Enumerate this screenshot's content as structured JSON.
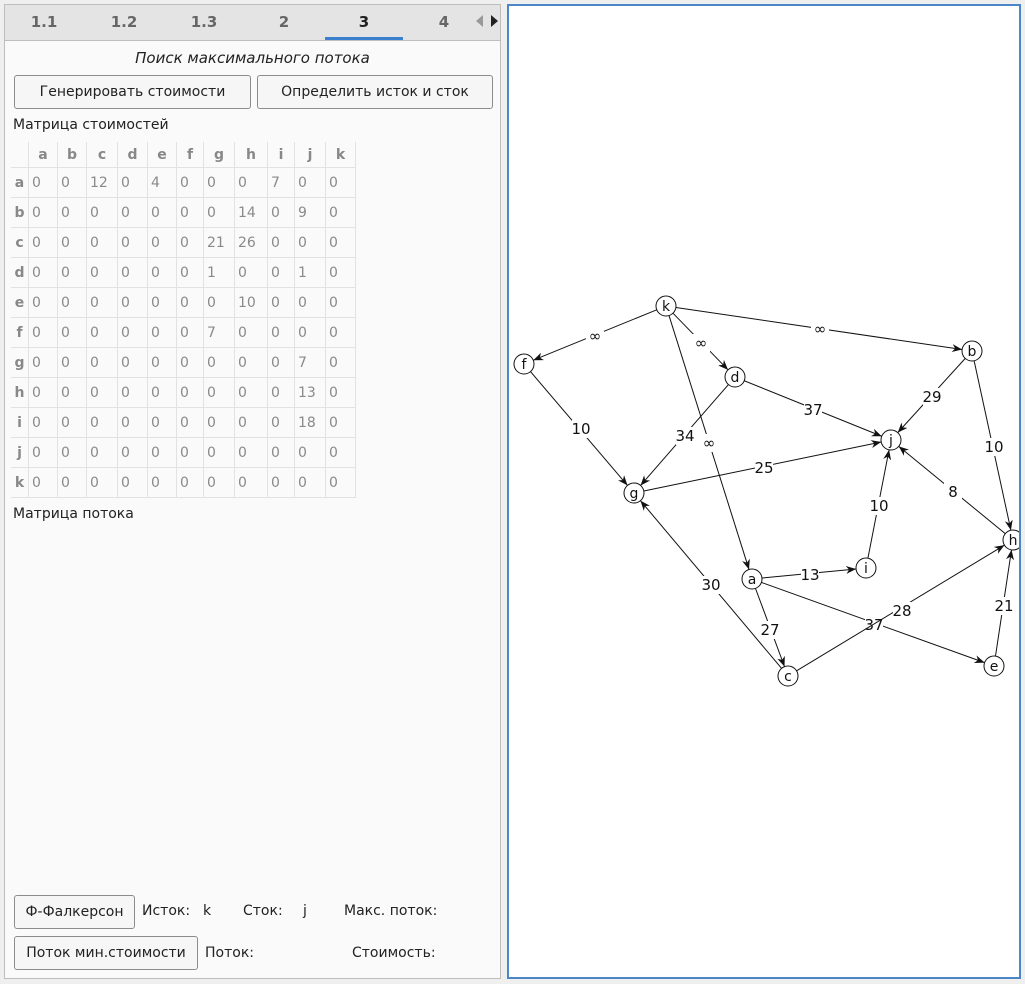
{
  "tabs": [
    {
      "label": "1.1",
      "active": false
    },
    {
      "label": "1.2",
      "active": false
    },
    {
      "label": "1.3",
      "active": false
    },
    {
      "label": "2",
      "active": false
    },
    {
      "label": "3",
      "active": true
    },
    {
      "label": "4",
      "active": false
    }
  ],
  "title": "Поиск максимального потока",
  "buttons": {
    "generate": "Генерировать стоимости",
    "determine": "Определить исток и сток",
    "ford_fulkerson": "Ф-Фалкерсон",
    "min_cost_flow": "Поток мин.стоимости"
  },
  "cost_matrix": {
    "label": "Матрица стоимостей",
    "columns": [
      "a",
      "b",
      "c",
      "d",
      "e",
      "f",
      "g",
      "h",
      "i",
      "j",
      "k"
    ],
    "rows": [
      {
        "name": "a",
        "values": [
          "0",
          "0",
          "12",
          "0",
          "4",
          "0",
          "0",
          "0",
          "7",
          "0",
          "0"
        ]
      },
      {
        "name": "b",
        "values": [
          "0",
          "0",
          "0",
          "0",
          "0",
          "0",
          "0",
          "14",
          "0",
          "9",
          "0"
        ]
      },
      {
        "name": "c",
        "values": [
          "0",
          "0",
          "0",
          "0",
          "0",
          "0",
          "21",
          "26",
          "0",
          "0",
          "0"
        ]
      },
      {
        "name": "d",
        "values": [
          "0",
          "0",
          "0",
          "0",
          "0",
          "0",
          "1",
          "0",
          "0",
          "1",
          "0"
        ]
      },
      {
        "name": "e",
        "values": [
          "0",
          "0",
          "0",
          "0",
          "0",
          "0",
          "0",
          "10",
          "0",
          "0",
          "0"
        ]
      },
      {
        "name": "f",
        "values": [
          "0",
          "0",
          "0",
          "0",
          "0",
          "0",
          "7",
          "0",
          "0",
          "0",
          "0"
        ]
      },
      {
        "name": "g",
        "values": [
          "0",
          "0",
          "0",
          "0",
          "0",
          "0",
          "0",
          "0",
          "0",
          "7",
          "0"
        ]
      },
      {
        "name": "h",
        "values": [
          "0",
          "0",
          "0",
          "0",
          "0",
          "0",
          "0",
          "0",
          "0",
          "13",
          "0"
        ]
      },
      {
        "name": "i",
        "values": [
          "0",
          "0",
          "0",
          "0",
          "0",
          "0",
          "0",
          "0",
          "0",
          "18",
          "0"
        ]
      },
      {
        "name": "j",
        "values": [
          "0",
          "0",
          "0",
          "0",
          "0",
          "0",
          "0",
          "0",
          "0",
          "0",
          "0"
        ]
      },
      {
        "name": "k",
        "values": [
          "0",
          "0",
          "0",
          "0",
          "0",
          "0",
          "0",
          "0",
          "0",
          "0",
          "0"
        ]
      }
    ]
  },
  "flow_matrix_label": "Матрица потока",
  "bottom": {
    "source_label": "Исток:",
    "source_value": "k",
    "sink_label": "Сток:",
    "sink_value": "j",
    "max_flow_label": "Макс. поток:",
    "flow_label": "Поток:",
    "cost_label": "Стоимость:"
  },
  "graph": {
    "nodes": [
      "k",
      "f",
      "d",
      "b",
      "j",
      "g",
      "a",
      "i",
      "h",
      "c",
      "e"
    ],
    "edges": [
      {
        "from": "k",
        "to": "f",
        "label": "∞"
      },
      {
        "from": "k",
        "to": "d",
        "label": "∞"
      },
      {
        "from": "k",
        "to": "b",
        "label": "∞"
      },
      {
        "from": "k",
        "to": "a",
        "label": "∞"
      },
      {
        "from": "f",
        "to": "g",
        "label": "10"
      },
      {
        "from": "d",
        "to": "g",
        "label": "34"
      },
      {
        "from": "d",
        "to": "j",
        "label": "37"
      },
      {
        "from": "b",
        "to": "j",
        "label": "29"
      },
      {
        "from": "b",
        "to": "h",
        "label": "10"
      },
      {
        "from": "g",
        "to": "j",
        "label": "25"
      },
      {
        "from": "h",
        "to": "j",
        "label": "8"
      },
      {
        "from": "i",
        "to": "j",
        "label": "10"
      },
      {
        "from": "a",
        "to": "i",
        "label": "13"
      },
      {
        "from": "a",
        "to": "c",
        "label": "27"
      },
      {
        "from": "a",
        "to": "e",
        "label": "37"
      },
      {
        "from": "c",
        "to": "g",
        "label": "30"
      },
      {
        "from": "c",
        "to": "h",
        "label": "28"
      },
      {
        "from": "e",
        "to": "h",
        "label": "21"
      }
    ]
  }
}
